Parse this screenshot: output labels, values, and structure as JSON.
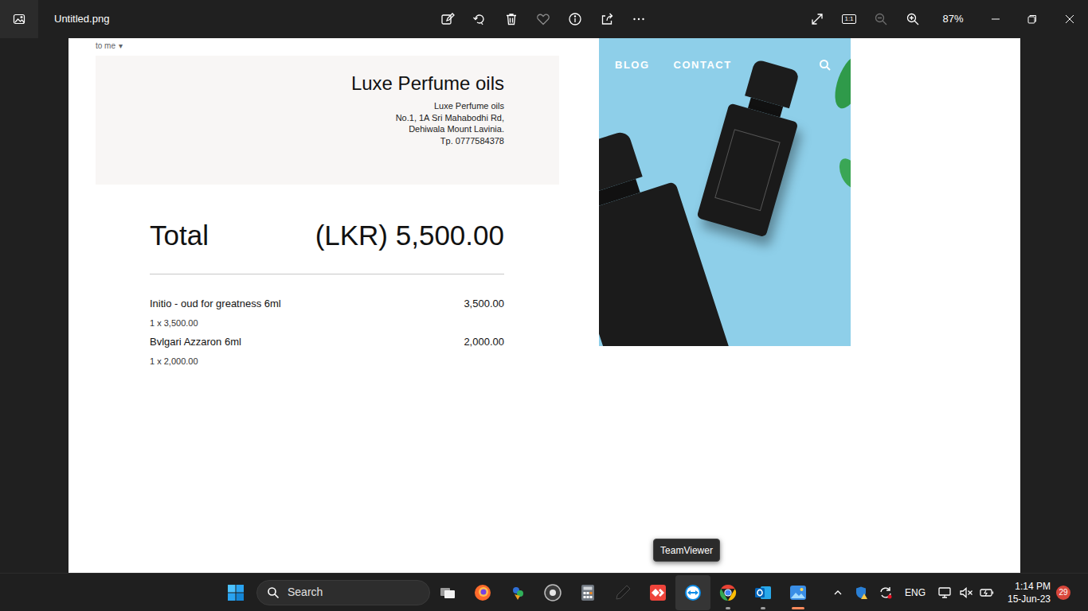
{
  "window": {
    "title": "Untitled.png",
    "actual_size": "1:1",
    "zoom": "87%",
    "zoom_out": {
      "disabled": true
    }
  },
  "image": {
    "email": {
      "recipient": "to me",
      "recipient_caret": "▾",
      "shop_name": "Luxe Perfume oils",
      "address_lines": [
        "Luxe Perfume oils",
        "No.1, 1A Sri Mahabodhi Rd,",
        "Dehiwala Mount Lavinia.",
        "Tp. 0777584378"
      ],
      "total_label": "Total",
      "total_value": "(LKR) 5,500.00",
      "items": [
        {
          "name": "Initio - oud for greatness 6ml",
          "price": "3,500.00",
          "quantity": "1 x 3,500.00"
        },
        {
          "name": "Bvlgari Azzaron 6ml",
          "price": "2,000.00",
          "quantity": "1 x 2,000.00"
        }
      ]
    },
    "website": {
      "nav": [
        "BLOG",
        "CONTACT"
      ]
    }
  },
  "tooltip": "TeamViewer",
  "taskbar": {
    "search": "Search",
    "apps": [
      {
        "kind": "task-view",
        "running": false,
        "active": false,
        "hovered": false
      },
      {
        "kind": "firefox",
        "running": false,
        "active": false,
        "hovered": false
      },
      {
        "kind": "colorful",
        "running": false,
        "active": false,
        "hovered": false
      },
      {
        "kind": "obs",
        "running": false,
        "active": false,
        "hovered": false
      },
      {
        "kind": "calculator",
        "running": false,
        "active": false,
        "hovered": false
      },
      {
        "kind": "pen",
        "running": false,
        "active": false,
        "hovered": false
      },
      {
        "kind": "anydesk",
        "running": false,
        "active": false,
        "hovered": false
      },
      {
        "kind": "teamviewer",
        "running": false,
        "active": false,
        "hovered": true
      },
      {
        "kind": "chrome",
        "running": true,
        "active": false,
        "hovered": false
      },
      {
        "kind": "outlook",
        "running": true,
        "active": false,
        "hovered": false
      },
      {
        "kind": "photos",
        "running": true,
        "active": true,
        "hovered": false
      }
    ],
    "language": "ENG",
    "time": "1:14 PM",
    "date": "15-Jun-23",
    "notification_count": "29"
  }
}
